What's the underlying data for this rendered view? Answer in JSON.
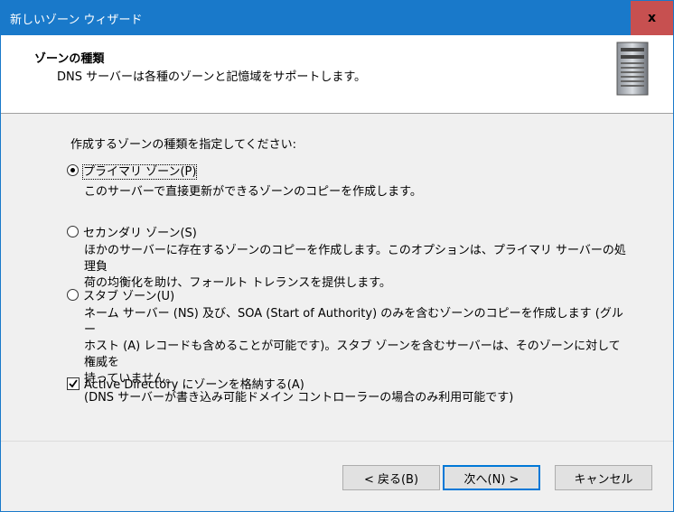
{
  "window": {
    "title": "新しいゾーン ウィザード",
    "close_label": "x"
  },
  "header": {
    "heading": "ゾーンの種類",
    "subheading": "DNS サーバーは各種のゾーンと記憶域をサポートします。",
    "icon": "server-icon"
  },
  "prompt": "作成するゾーンの種類を指定してください:",
  "options": [
    {
      "label": "プライマリ ゾーン(P)",
      "checked": true,
      "desc_lines": [
        "このサーバーで直接更新ができるゾーンのコピーを作成します。"
      ]
    },
    {
      "label": "セカンダリ ゾーン(S)",
      "checked": false,
      "desc_lines": [
        "ほかのサーバーに存在するゾーンのコピーを作成します。このオプションは、プライマリ サーバーの処理負",
        "荷の均衡化を助け、フォールト トレランスを提供します。"
      ]
    },
    {
      "label": "スタブ ゾーン(U)",
      "checked": false,
      "desc_lines": [
        "ネーム サーバー (NS) 及び、SOA (Start of Authority) のみを含むゾーンのコピーを作成します (グルー",
        "ホスト (A) レコードも含めることが可能です)。スタブ ゾーンを含むサーバーは、そのゾーンに対して権威を",
        "持っていません。"
      ]
    }
  ],
  "ad_checkbox": {
    "label": "Active Directory にゾーンを格納する(A)",
    "checked": true,
    "desc": "(DNS サーバーが書き込み可能ドメイン コントローラーの場合のみ利用可能です)"
  },
  "buttons": {
    "back": "< 戻る(B)",
    "next": "次へ(N) >",
    "cancel": "キャンセル"
  }
}
